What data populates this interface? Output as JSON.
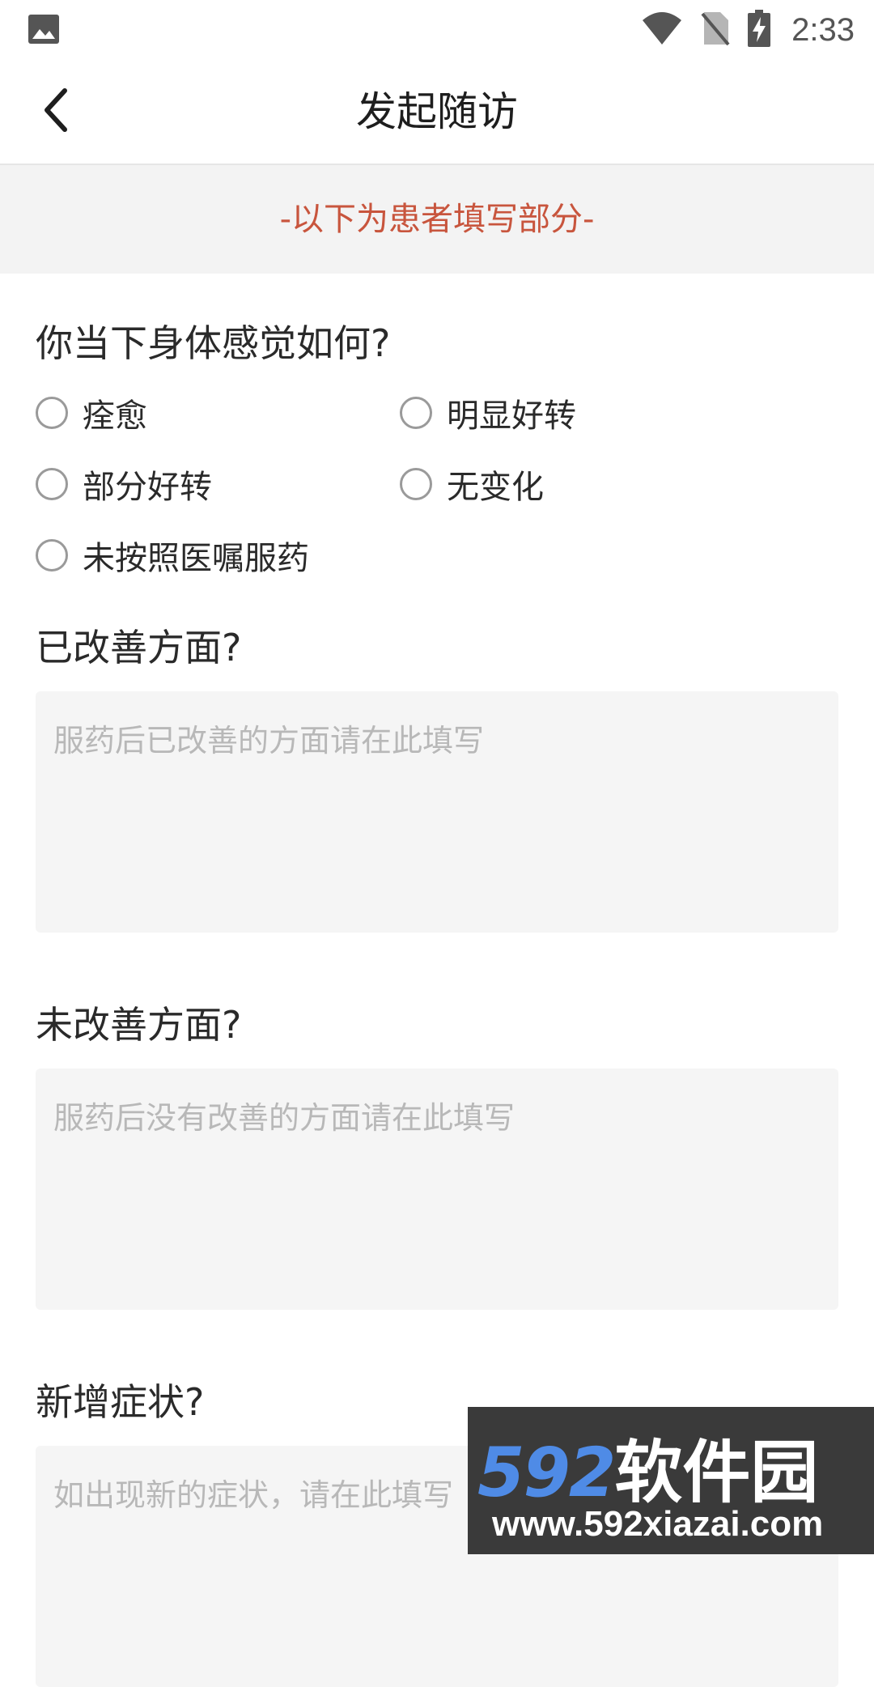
{
  "status_bar": {
    "time": "2:33",
    "icons": [
      "gallery-icon",
      "wifi-icon",
      "no-sim-icon",
      "battery-charging-icon"
    ]
  },
  "app_bar": {
    "title": "发起随访",
    "back_icon": "chevron-left-icon"
  },
  "section_banner": {
    "text": "-以下为患者填写部分-",
    "color": "#c8553d"
  },
  "form": {
    "q1": {
      "question": "你当下身体感觉如何?",
      "options": [
        {
          "label": "痊愈",
          "checked": false
        },
        {
          "label": "明显好转",
          "checked": false
        },
        {
          "label": "部分好转",
          "checked": false
        },
        {
          "label": "无变化",
          "checked": false
        },
        {
          "label": "未按照医嘱服药",
          "checked": false
        }
      ]
    },
    "q2": {
      "question": "已改善方面?",
      "value": "",
      "placeholder": "服药后已改善的方面请在此填写"
    },
    "q3": {
      "question": "未改善方面?",
      "value": "",
      "placeholder": "服药后没有改善的方面请在此填写"
    },
    "q4": {
      "question": "新增症状?",
      "value": "",
      "placeholder": "如出现新的症状，请在此填写"
    }
  },
  "watermark": {
    "logo_digits": "592",
    "logo_text": "软件园",
    "url": "www.592xiazai.com"
  }
}
